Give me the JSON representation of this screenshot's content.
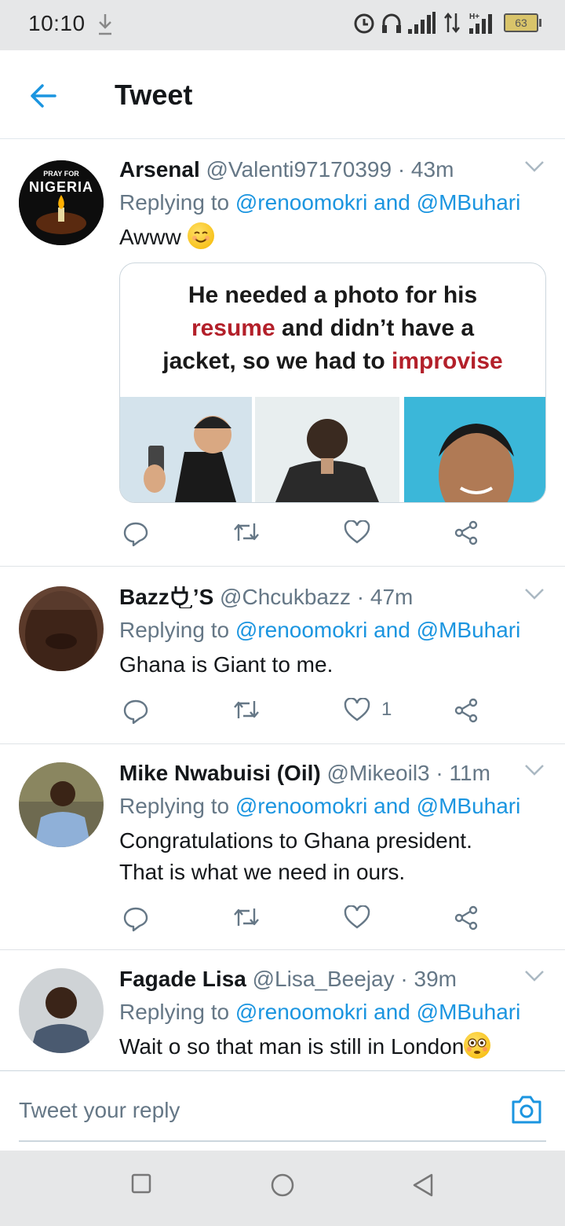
{
  "status": {
    "time": "10:10",
    "battery": "63",
    "icons": [
      "download-icon",
      "alarm-icon",
      "headphones-icon",
      "signal-icon",
      "data-arrows-icon",
      "hplus-signal-icon",
      "battery-icon"
    ]
  },
  "header": {
    "title": "Tweet",
    "back_icon": "back-arrow-icon"
  },
  "tweets": [
    {
      "name": "Arsenal",
      "handle": "@Valenti97170399",
      "time": "· 43m",
      "replying_prefix": "Replying to",
      "mention1": "@renoomokri",
      "and": "and",
      "mention2": "@MBuhari",
      "text": "Awww",
      "avatar_text_top": "PRAY FOR",
      "avatar_text_main": "NIGERIA",
      "media": {
        "line1": "He needed a photo for his",
        "line2_red": "resume",
        "line2_rest": "and didn’t have a",
        "line3_rest": "jacket, so we had to",
        "line3_red": "improvise"
      },
      "likes": ""
    },
    {
      "name": "Bazz",
      "name_suffix": "’S",
      "handle": "@Chcukbazz",
      "time": "· 47m",
      "replying_prefix": "Replying to",
      "mention1": "@renoomokri",
      "and": "and",
      "mention2": "@MBuhari",
      "text": "Ghana is Giant to me.",
      "likes": "1"
    },
    {
      "name": "Mike Nwabuisi (Oil)",
      "handle": "@Mikeoil3",
      "time": "· 11m",
      "replying_prefix": "Replying to",
      "mention1": "@renoomokri",
      "and": "and",
      "mention2": "@MBuhari",
      "text_line1": "Congratulations to Ghana president.",
      "text_line2": "That is what we need in ours.",
      "likes": ""
    },
    {
      "name": "Fagade Lisa",
      "handle": "@Lisa_Beejay",
      "time": "· 39m",
      "replying_prefix": "Replying to",
      "mention1": "@renoomokri",
      "and": "and",
      "mention2": "@MBuhari",
      "text": "Wait o so that man is still in London"
    }
  ],
  "reply": {
    "placeholder": "Tweet your reply"
  },
  "colors": {
    "accent": "#1b95e0",
    "secondary_text": "#657786",
    "border": "#e1e8ed"
  }
}
